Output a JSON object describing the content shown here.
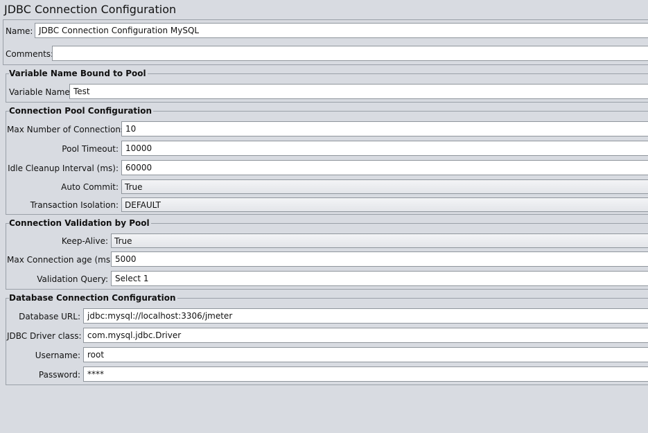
{
  "window": {
    "title": "JDBC Connection Configuration"
  },
  "top": {
    "name_label": "Name:",
    "name_value": "JDBC Connection Configuration MySQL",
    "comments_label": "Comments:",
    "comments_value": ""
  },
  "variable_pool": {
    "title": "Variable Name Bound to Pool",
    "variable_name_label": "Variable Name:",
    "variable_name_value": "Test"
  },
  "connection_pool": {
    "title": "Connection Pool Configuration",
    "max_connections_label": "Max Number of Connections:",
    "max_connections_value": "10",
    "pool_timeout_label": "Pool Timeout:",
    "pool_timeout_value": "10000",
    "idle_cleanup_label": "Idle Cleanup Interval (ms):",
    "idle_cleanup_value": "60000",
    "auto_commit_label": "Auto Commit:",
    "auto_commit_value": "True",
    "transaction_isolation_label": "Transaction Isolation:",
    "transaction_isolation_value": "DEFAULT"
  },
  "validation": {
    "title": "Connection Validation by Pool",
    "keep_alive_label": "Keep-Alive:",
    "keep_alive_value": "True",
    "max_age_label": "Max Connection age (ms):",
    "max_age_value": "5000",
    "validation_query_label": "Validation Query:",
    "validation_query_value": "Select 1"
  },
  "database": {
    "title": "Database Connection Configuration",
    "url_label": "Database URL:",
    "url_value": "jdbc:mysql://localhost:3306/jmeter",
    "driver_label": "JDBC Driver class:",
    "driver_value": "com.mysql.jdbc.Driver",
    "username_label": "Username:",
    "username_value": "root",
    "password_label": "Password:",
    "password_value": "****"
  }
}
